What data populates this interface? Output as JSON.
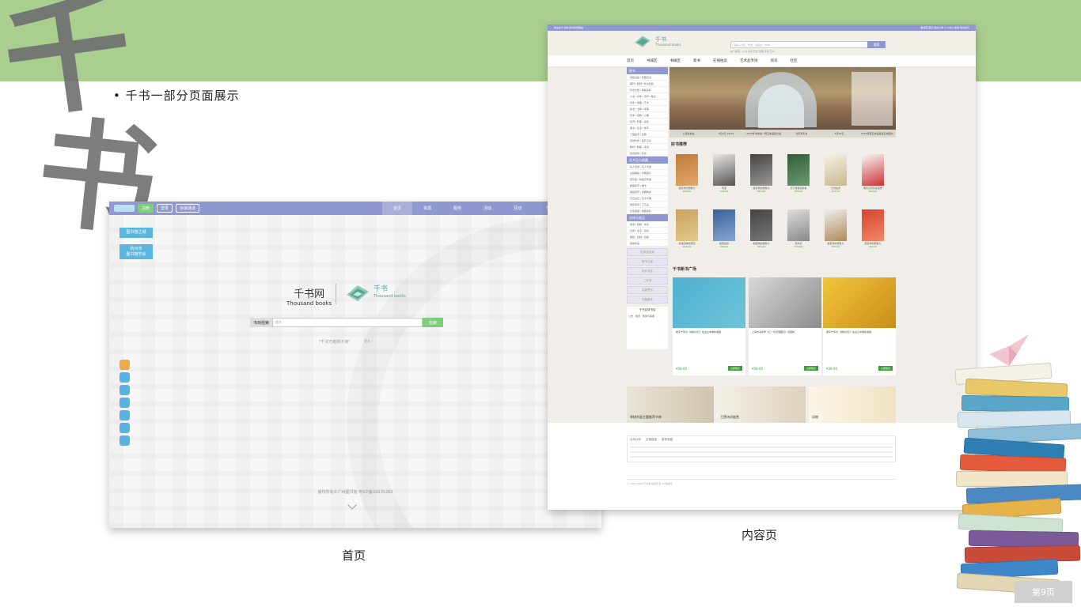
{
  "slide": {
    "brush_chars": [
      "千",
      "书"
    ],
    "subtitle": "千书一部分页面展示",
    "caption_home": "首页",
    "caption_content": "内容页",
    "page_button": "第9页",
    "colors": {
      "band_green": "#a9cf8f",
      "nav_purple": "#8f98d0",
      "accent_green": "#7dcf7e"
    }
  },
  "home": {
    "nav_buttons": [
      "注册",
      "登录",
      "快速通道"
    ],
    "nav_tabs": [
      "首页",
      "资源",
      "服务",
      "活动",
      "互动",
      "专"
    ],
    "side_buttons": [
      "图书馆之城",
      "杭州市\n图书馆学会"
    ],
    "site_name_cn": "千书网",
    "site_name_en": "Thousand books",
    "logo_cn": "千书",
    "logo_en": "Thousand books",
    "search_label": "书目检索",
    "search_placeholder": "题名",
    "search_button": "检索",
    "motto": "\"千书万卷默不读\"",
    "more": "更多 »",
    "icon_names": [
      "home-icon",
      "cart-icon",
      "edit-icon",
      "shield-icon",
      "truck-icon",
      "car-icon",
      "wallet-icon"
    ],
    "footer": "版权所有©广州图书馆 粤ICP备10235282"
  },
  "content": {
    "topbar_left": "欢迎来千书网 敬请登录网站",
    "topbar_right": "图书馆 首页 我的订单 个人中心 客服 联系我们",
    "logo_cn": "千书",
    "logo_en": "Thousand books",
    "search_placeholder": "请输入书名、作者、出版社、ISBN",
    "search_button": "搜索",
    "hot_words": "热门搜索：小说 文学 历史 经典 哲学 艺术",
    "nav": [
      "首页",
      "书城区",
      "书摊区",
      "新书",
      "在线拍卖",
      "艺术品专场",
      "资讯",
      "社区"
    ],
    "sidebar_head_1": "图书",
    "sidebar_items_1": [
      "线装古籍 / 民国旧书",
      "期刊 / 报纸 / 外文原版",
      "科学文献 / 教辅资料",
      "小说 / 文学 / 诗词 / 散文",
      "历史 / 地理 / 艺术",
      "政治 / 法律 / 军事",
      "哲学 / 宗教 / 心理",
      "经济 / 管理 / 综合",
      "童书 / 生活 / 体育",
      "工程技术 / 生物",
      "自然科学 / 医药卫生",
      "教材 / 教辅 / 考试",
      "综合其他 / 杂志"
    ],
    "sidebar_head_2": "艺术品与收藏",
    "sidebar_items_2": [
      "名人墨迹 / 名人手迹",
      "古籍碑帖 / 印刷拓片",
      "连环画 / 版画宣传画",
      "邮票钱币 / 磁卡",
      "铜钱纸币 / 瓷器陶瓷",
      "玉石古玩 / 竹木牙雕",
      "摄影家具 / 工艺品",
      "红色收藏 / 收藏资料"
    ],
    "sidebar_head_3": "实体与商品",
    "sidebar_items_3": [
      "笔墨 / 纸砚 / 文房",
      "日用 / 生活 / 百货",
      "服装 / 鞋帽 / 包袋",
      "其他商品"
    ],
    "side_tiles": [
      "艺术品拍卖",
      "新书上架",
      "特价专区",
      "二手书",
      "名家签名",
      "古籍善本"
    ],
    "side_list_title": "千书实体书店",
    "side_list_tabs": [
      "公告",
      "规则",
      "帮助与客服"
    ],
    "banner_tabs": [
      "上海书友会",
      "5月2日 18:00",
      "2019年书友会一周五本品鉴大会",
      "北京书平台",
      "5月22日",
      "2019年度五本品鉴会五本图书"
    ],
    "section_recommend": "好书推荐",
    "recommend_row1": [
      {
        "title": "健走学的想象力",
        "price": "¥30.00"
      },
      {
        "title": "写话",
        "price": "¥18.00"
      },
      {
        "title": "健走学的想象力",
        "price": "¥20.00"
      },
      {
        "title": "天下旅游实地说",
        "price": "¥30.00"
      },
      {
        "title": "九月往昔",
        "price": "¥79.75"
      },
      {
        "title": "明清之际外来思想",
        "price": "¥30.00"
      }
    ],
    "recommend_row2": [
      {
        "title": "考拉园林史研究",
        "price": "¥22.00"
      },
      {
        "title": "极限运动",
        "price": "¥35.00"
      },
      {
        "title": "健康学的想象力",
        "price": "¥45.00"
      },
      {
        "title": "南洋记",
        "price": "¥30.00"
      },
      {
        "title": "健走学的想象力",
        "price": "¥30.00"
      },
      {
        "title": "健走学的想象力",
        "price": "¥30.00"
      }
    ],
    "section_new": "千书新书广场",
    "cards": [
      {
        "text": "梁宇宁专访《城的记忆》在设立中重新发掘",
        "price": "¥38.00",
        "buy": "立即购买"
      },
      {
        "text": "上海市书评学《江一切无限图引》诗结构",
        "price": "¥38.00",
        "buy": "立即购买"
      },
      {
        "text": "梁宇宁专访《城的记忆》在设立中重新发掘",
        "price": "¥38.00",
        "buy": "立即购买"
      }
    ],
    "strips": [
      "琴棋书画主题推荐书单",
      "王德诗词鉴赏",
      "风物"
    ],
    "footer_tabs": [
      "合作伙伴",
      "友情链接",
      "推荐收藏"
    ],
    "copyright": "© 2002-2019 千书网 版权所有  ICP备案号"
  }
}
